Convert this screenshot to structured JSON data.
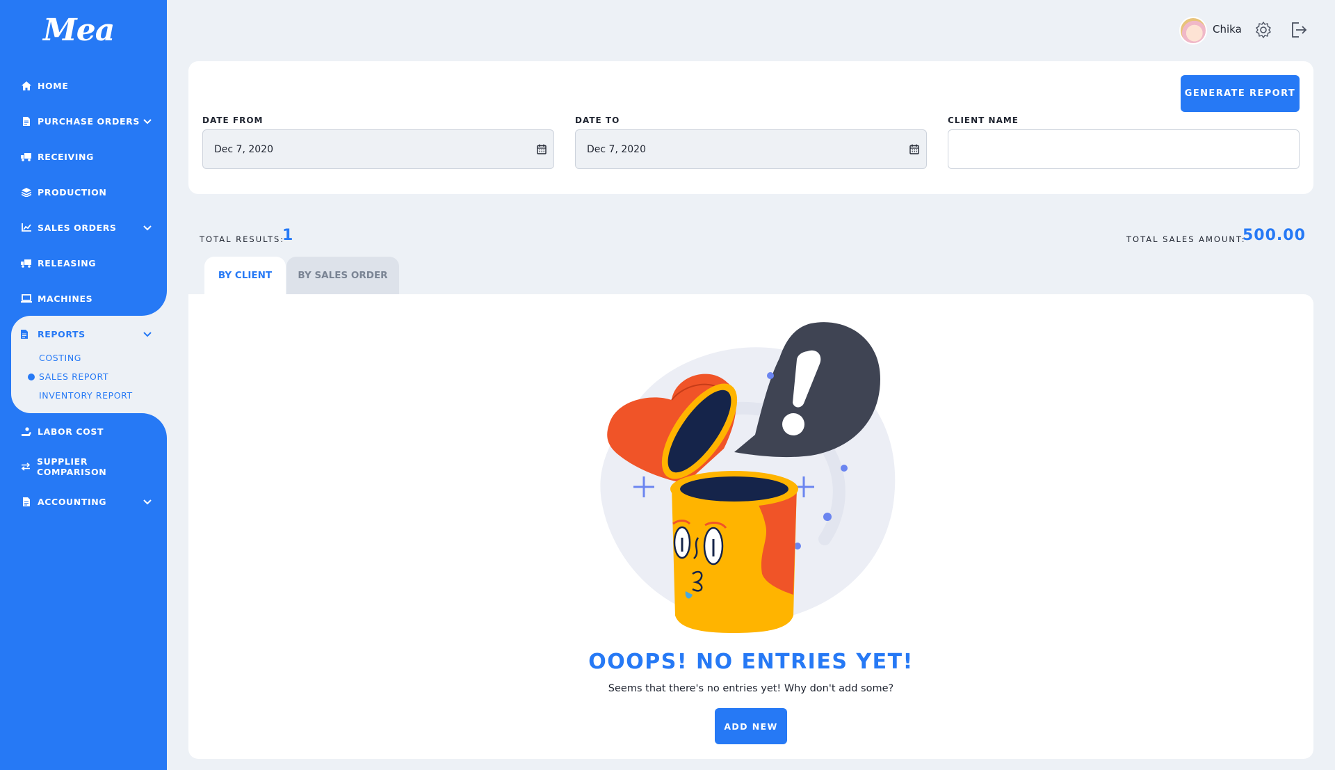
{
  "app": {
    "logo": "Mea"
  },
  "sidebar": {
    "items": [
      {
        "label": "HOME",
        "icon": "home-icon"
      },
      {
        "label": "PURCHASE ORDERS",
        "icon": "document-icon"
      },
      {
        "label": "RECEIVING",
        "icon": "truck-icon"
      },
      {
        "label": "PRODUCTION",
        "icon": "layers-icon"
      },
      {
        "label": "SALES ORDERS",
        "icon": "chart-icon"
      },
      {
        "label": "RELEASING",
        "icon": "truck-icon"
      },
      {
        "label": "MACHINES",
        "icon": "laptop-icon"
      },
      {
        "label": "REPORTS",
        "icon": "document-icon"
      },
      {
        "label": "LABOR COST",
        "icon": "worker-icon"
      },
      {
        "label": "SUPPLIER COMPARISON",
        "icon": "swap-icon"
      },
      {
        "label": "ACCOUNTING",
        "icon": "document-icon"
      }
    ],
    "reports_sub": [
      {
        "label": "COSTING"
      },
      {
        "label": "SALES REPORT",
        "active": true
      },
      {
        "label": "INVENTORY REPORT"
      }
    ],
    "active_color": "#2679f5"
  },
  "header": {
    "username": "Chika"
  },
  "filters": {
    "generate_label": "GENERATE REPORT",
    "date_from_label": "DATE FROM",
    "date_from_value": "Dec 7, 2020",
    "date_to_label": "DATE TO",
    "date_to_value": "Dec 7, 2020",
    "client_name_label": "CLIENT NAME",
    "client_name_value": ""
  },
  "totals": {
    "results_label": "TOTAL RESULTS:",
    "results_value": "1",
    "sales_label": "TOTAL SALES AMOUNT:",
    "sales_value": "500.00"
  },
  "tabs": [
    {
      "label": "BY CLIENT",
      "active": true
    },
    {
      "label": "BY SALES ORDER",
      "active": false
    }
  ],
  "empty_state": {
    "title": "OOOPS! NO ENTRIES YET!",
    "subtitle": "Seems that there's no entries yet! Why don't add some?",
    "button_label": "ADD NEW"
  },
  "colors": {
    "primary": "#2679f5",
    "background": "#edf1f6"
  }
}
